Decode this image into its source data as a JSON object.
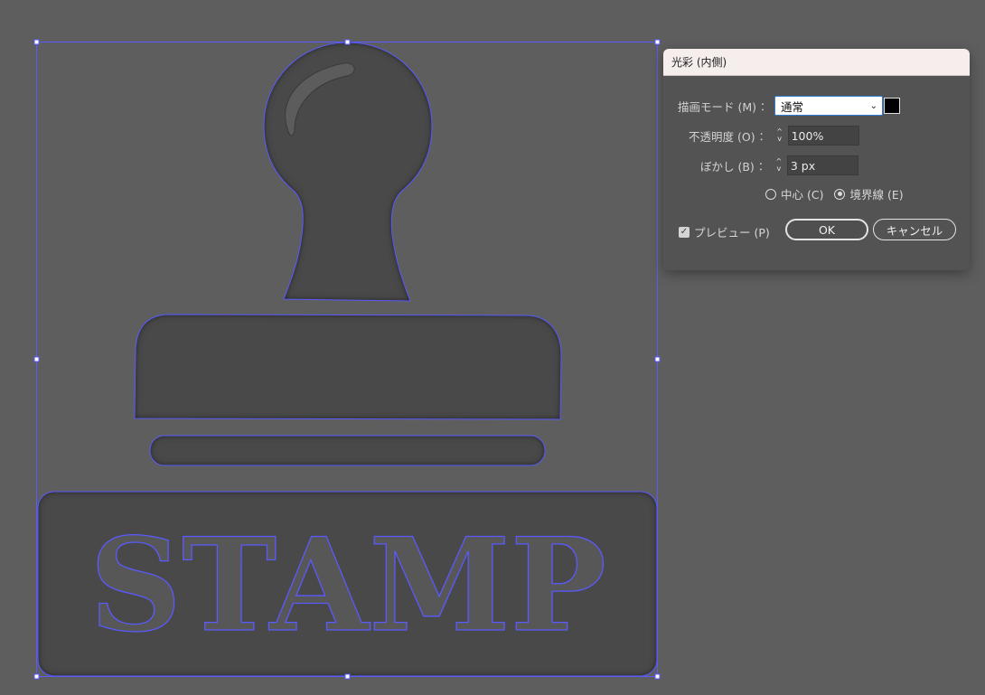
{
  "artwork": {
    "stamp_text": "STAMP",
    "selection_color": "#5a5aff",
    "shape_fill": "#4a4a4a",
    "background": "#5e5e5e"
  },
  "dialog": {
    "title": "光彩 (内側)",
    "mode_label": "描画モード (M)",
    "mode_value": "通常",
    "mode_icon": "chevron-down-icon",
    "glow_color": "#000000",
    "opacity_label": "不透明度 (O)",
    "opacity_value": "100%",
    "blur_label": "ぼかし (B)",
    "blur_value": "3 px",
    "colon": "：",
    "source_options": [
      {
        "label": "中心 (C)",
        "selected": false
      },
      {
        "label": "境界線 (E)",
        "selected": true
      }
    ],
    "preview_label": "プレビュー (P)",
    "preview_checked": true,
    "ok_label": "OK",
    "cancel_label": "キャンセル"
  }
}
